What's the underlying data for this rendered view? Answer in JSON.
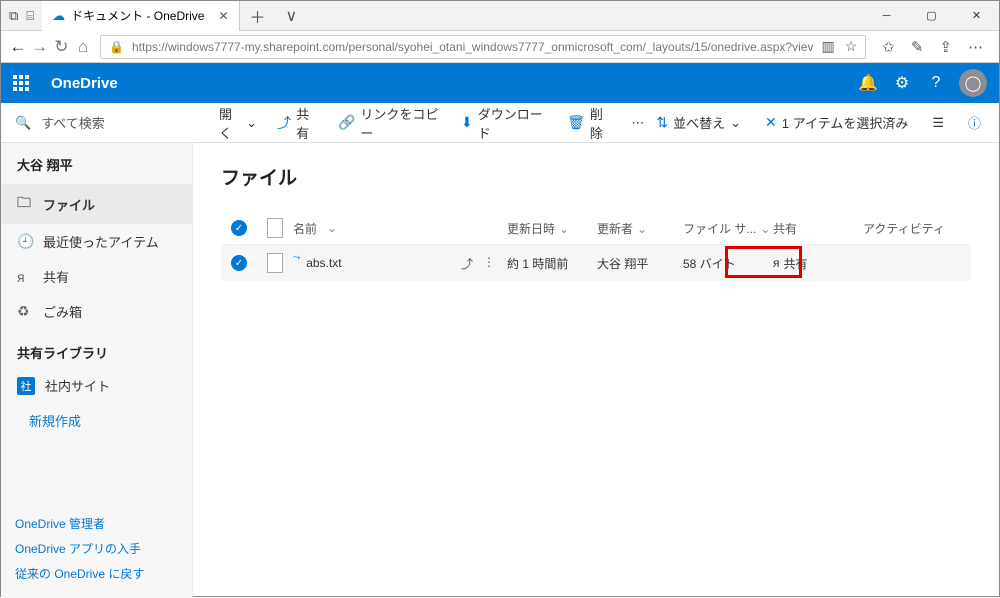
{
  "window": {
    "tab_title": "ドキュメント - OneDrive",
    "url": "https://windows7777-my.sharepoint.com/personal/syohei_otani_windows7777_onmicrosoft_com/_layouts/15/onedrive.aspx?viev"
  },
  "brand": {
    "app_name": "OneDrive"
  },
  "search": {
    "placeholder": "すべて検索"
  },
  "commands": {
    "open": "開く",
    "share": "共有",
    "copy_link": "リンクをコピー",
    "download": "ダウンロード",
    "delete": "削除",
    "sort": "並べ替え",
    "selected": "1 アイテムを選択済み"
  },
  "sidebar": {
    "user": "大谷 翔平",
    "items": [
      {
        "label": "ファイル",
        "icon": "folder-icon",
        "selected": true
      },
      {
        "label": "最近使ったアイテム",
        "icon": "clock-icon",
        "selected": false
      },
      {
        "label": "共有",
        "icon": "people-icon",
        "selected": false
      },
      {
        "label": "ごみ箱",
        "icon": "trash-icon",
        "selected": false
      }
    ],
    "shared_section": "共有ライブラリ",
    "library": {
      "label": "社内サイト",
      "badge": "社"
    },
    "new": "新規作成",
    "bottom": [
      "OneDrive 管理者",
      "OneDrive アプリの入手",
      "従来の OneDrive に戻す"
    ]
  },
  "page": {
    "title": "ファイル"
  },
  "columns": {
    "name": "名前",
    "modified": "更新日時",
    "modified_by": "更新者",
    "size": "ファイル サ...",
    "share": "共有",
    "activity": "アクティビティ"
  },
  "rows": [
    {
      "name": "abs.txt",
      "modified": "約 1 時間前",
      "modified_by": "大谷 翔平",
      "size": "58 バイト",
      "share": "共有"
    }
  ]
}
